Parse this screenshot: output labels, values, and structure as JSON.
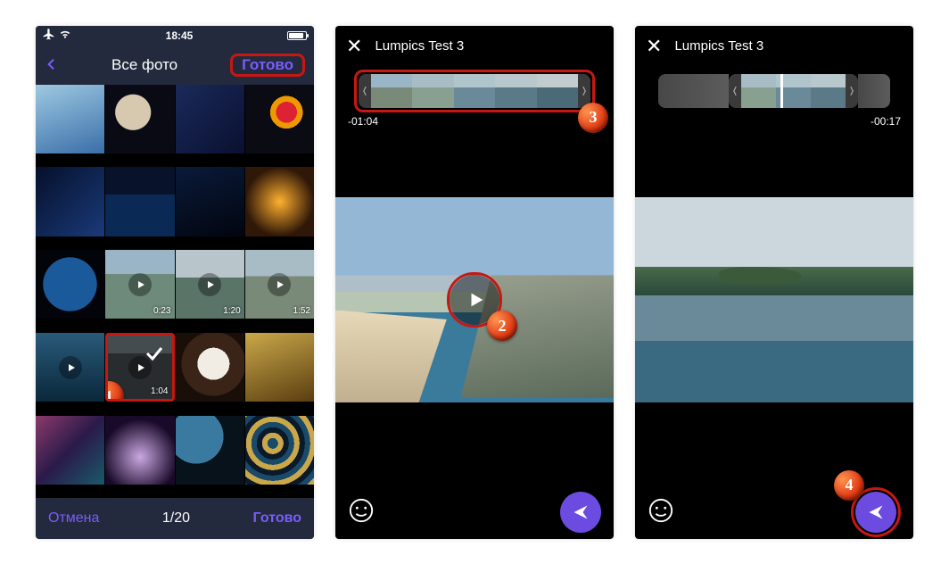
{
  "status": {
    "time": "18:45"
  },
  "picker": {
    "title": "Все фото",
    "done": "Готово",
    "cancel": "Отмена",
    "count": "1/20",
    "bottom_done": "Готово",
    "videos": {
      "v1": "0:23",
      "v2": "1:20",
      "v3": "1:52",
      "vsel": "1:04"
    }
  },
  "preview": {
    "chat_name": "Lumpics Test 3",
    "time_full": "-01:04",
    "time_trim": "-00:17"
  }
}
